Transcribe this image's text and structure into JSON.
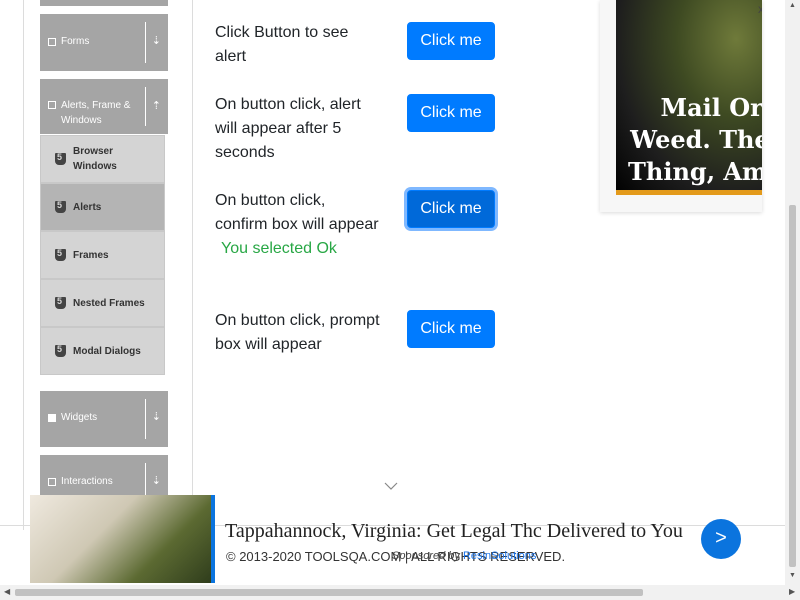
{
  "sidebar": {
    "groups": [
      {
        "label": "Forms",
        "icon": "form-icon",
        "arrow": "⇣"
      },
      {
        "label": "Alerts, Frame & Windows",
        "icon": "window-icon",
        "arrow": "⇡"
      },
      {
        "label": "Widgets",
        "icon": "widgets-icon",
        "arrow": "⇣"
      },
      {
        "label": "Interactions",
        "icon": "interactions-icon",
        "arrow": "⇣"
      }
    ],
    "items": [
      {
        "label": "Browser Windows"
      },
      {
        "label": "Alerts"
      },
      {
        "label": "Frames"
      },
      {
        "label": "Nested Frames"
      },
      {
        "label": "Modal Dialogs"
      }
    ]
  },
  "main": {
    "rows": [
      {
        "label": "Click Button to see alert",
        "button": "Click me"
      },
      {
        "label": "On button click, alert will appear after 5 seconds",
        "button": "Click me"
      },
      {
        "label": "On button click, confirm box will appear",
        "result": "You selected Ok",
        "button": "Click me"
      },
      {
        "label": "On button click, prompt box will appear",
        "button": "Click me"
      }
    ]
  },
  "ad_top": {
    "headline": "Mail Order Weed. The Real Thing, Amazing",
    "close": "x"
  },
  "ad_bottom": {
    "text": "Tappahannock, Virginia: Get Legal Thc Delivered to You",
    "go": ">"
  },
  "footer": {
    "copyright": "© 2013-2020 TOOLSQA.COM | ALL RIGHTS RESERVED.",
    "sponsored_prefix": "Sponsored by",
    "sponsor_name": "ResinSolutions"
  },
  "colors": {
    "primary": "#007bff",
    "success": "#28a745",
    "sidebar_group": "#a5a5a5"
  }
}
